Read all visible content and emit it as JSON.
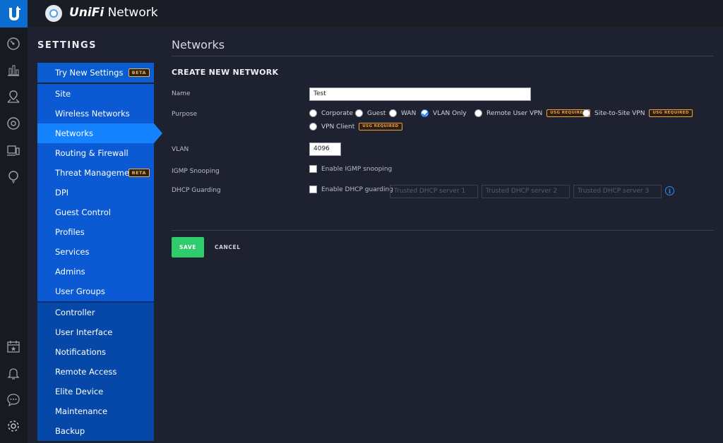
{
  "app": {
    "title_brand": "UniFi",
    "title_product": " Network"
  },
  "sidebar": {
    "heading": "SETTINGS",
    "try_new": {
      "label": "Try New Settings",
      "badge": "BETA"
    },
    "group1": [
      {
        "label": "Site"
      },
      {
        "label": "Wireless Networks"
      },
      {
        "label": "Networks",
        "active": true
      },
      {
        "label": "Routing & Firewall"
      },
      {
        "label": "Threat Management",
        "badge": "BETA"
      },
      {
        "label": "DPI"
      },
      {
        "label": "Guest Control"
      },
      {
        "label": "Profiles"
      },
      {
        "label": "Services"
      },
      {
        "label": "Admins"
      },
      {
        "label": "User Groups"
      }
    ],
    "group2": [
      {
        "label": "Controller"
      },
      {
        "label": "User Interface"
      },
      {
        "label": "Notifications"
      },
      {
        "label": "Remote Access"
      },
      {
        "label": "Elite Device"
      },
      {
        "label": "Maintenance"
      },
      {
        "label": "Backup"
      }
    ]
  },
  "main": {
    "page_title": "Networks",
    "section_title": "CREATE NEW NETWORK",
    "fields": {
      "name_label": "Name",
      "name_value": "Test",
      "purpose_label": "Purpose",
      "purpose_options": [
        {
          "label": "Corporate",
          "checked": false
        },
        {
          "label": "Guest",
          "checked": false
        },
        {
          "label": "WAN",
          "checked": false
        },
        {
          "label": "VLAN Only",
          "checked": true
        },
        {
          "label": "Remote User VPN",
          "checked": false,
          "badge": "USG REQUIRED"
        },
        {
          "label": "Site-to-Site VPN",
          "checked": false,
          "badge": "USG REQUIRED"
        },
        {
          "label": "VPN Client",
          "checked": false,
          "badge": "USG REQUIRED"
        }
      ],
      "vlan_label": "VLAN",
      "vlan_value": "4096",
      "igmp_label": "IGMP Snooping",
      "igmp_option": "Enable IGMP snooping",
      "dhcp_label": "DHCP Guarding",
      "dhcp_option": "Enable DHCP guarding",
      "dhcp_server_placeholders": [
        "Trusted DHCP server 1",
        "Trusted DHCP server 2",
        "Trusted DHCP server 3"
      ],
      "info_glyph": "i"
    },
    "buttons": {
      "save": "SAVE",
      "cancel": "CANCEL"
    }
  },
  "icons": {
    "rail_top": [
      "dashboard-icon",
      "statistics-icon",
      "map-icon",
      "devices-icon",
      "clients-icon",
      "insights-icon"
    ],
    "rail_bottom": [
      "events-icon",
      "alerts-icon",
      "chat-icon",
      "settings-gear-icon"
    ]
  },
  "colors": {
    "accent": "#0a6ed1",
    "active_nav": "#1583ff",
    "save_green": "#2ecc6b",
    "badge_orange": "#f0a040"
  }
}
